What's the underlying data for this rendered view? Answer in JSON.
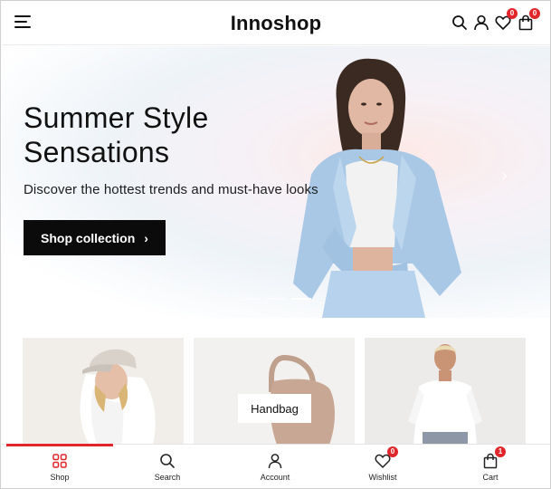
{
  "header": {
    "logo": "Innoshop",
    "wishlist_count": "0",
    "cart_count": "0"
  },
  "hero": {
    "title_line1": "Summer Style",
    "title_line2": "Sensations",
    "subtitle": "Discover the hottest trends and must-have looks",
    "cta_label": "Shop collection",
    "slides": 3,
    "active_slide": 3
  },
  "categories": [
    {
      "label": ""
    },
    {
      "label": "Handbag"
    },
    {
      "label": ""
    }
  ],
  "bottom_nav": {
    "items": [
      {
        "label": "Shop",
        "icon": "grid-icon",
        "active": true
      },
      {
        "label": "Search",
        "icon": "search-icon"
      },
      {
        "label": "Account",
        "icon": "user-icon"
      },
      {
        "label": "Wishlist",
        "icon": "heart-icon",
        "badge": "0"
      },
      {
        "label": "Cart",
        "icon": "bag-icon",
        "badge": "1"
      }
    ]
  },
  "colors": {
    "accent": "#e0262b",
    "text": "#111111",
    "cta_bg": "#0b0b0b"
  }
}
